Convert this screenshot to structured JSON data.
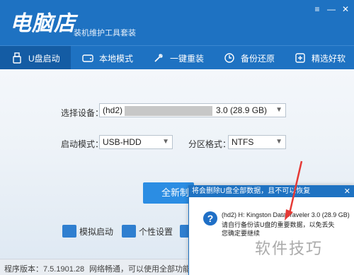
{
  "app": {
    "logo": "电脑店",
    "subtitle": "装机维护工具套装",
    "window_controls": [
      "≡",
      "—",
      "✕"
    ]
  },
  "nav": {
    "items": [
      {
        "label": "U盘启动",
        "icon": "usb-icon"
      },
      {
        "label": "本地模式",
        "icon": "hdd-icon"
      },
      {
        "label": "一键重装",
        "icon": "tools-icon"
      },
      {
        "label": "备份还原",
        "icon": "history-icon"
      },
      {
        "label": "精选好软",
        "icon": "apps-icon"
      }
    ],
    "active_index": 0
  },
  "form": {
    "device_label": "选择设备：",
    "device_value_prefix": "(hd2)",
    "device_value_suffix": "3.0 (28.9 GB)",
    "boot_mode_label": "启动模式：",
    "boot_mode_value": "USB-HDD",
    "partition_label": "分区格式：",
    "partition_value": "NTFS"
  },
  "actions": {
    "primary_label": "全新制作",
    "simulate_label": "模拟启动",
    "personalize_label": "个性设置"
  },
  "status": {
    "version": "程序版本：7.5.1901.28",
    "network": "网络畅通，可以使用全部功能"
  },
  "dialog": {
    "title": "将会删除U盘全部数据，且不可以恢复",
    "close": "✕",
    "question_icon": "?",
    "line1": "(hd2) H: Kingston DataTraveler 3.0 (28.9 GB)",
    "line2": "请自行备份该U盘的重要数据，以免丢失",
    "line3": "您确定要继续"
  },
  "watermark": "软件技巧",
  "colors": {
    "brand": "#1e72c2",
    "primary_button": "#2b8de3",
    "arrow": "#e53935"
  }
}
